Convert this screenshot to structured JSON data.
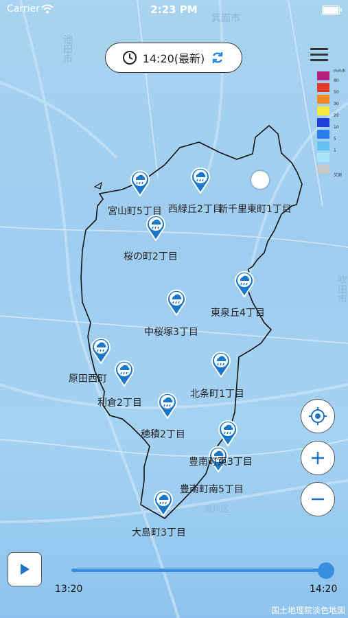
{
  "status_bar": {
    "carrier": "Carrier",
    "time": "2:23 PM"
  },
  "time_selector": {
    "label": "14:20(最新)"
  },
  "legend": {
    "unit": "mm/h",
    "items": [
      {
        "label": "80",
        "color": "#b0207c"
      },
      {
        "label": "50",
        "color": "#e03a2a"
      },
      {
        "label": "30",
        "color": "#f08a20"
      },
      {
        "label": "20",
        "color": "#f5e840"
      },
      {
        "label": "10",
        "color": "#1f3fd8"
      },
      {
        "label": "5",
        "color": "#2b7de8"
      },
      {
        "label": "1",
        "color": "#63c2f2"
      },
      {
        "label": "",
        "color": "#a9e6fb"
      },
      {
        "label": "欠測",
        "color": "#c8c8c8"
      }
    ]
  },
  "places": [
    {
      "name": "宮山町5丁目"
    },
    {
      "name": "西緑丘2丁目"
    },
    {
      "name": "新千里東町1丁目"
    },
    {
      "name": "桜の町2丁目"
    },
    {
      "name": "東泉丘4丁目"
    },
    {
      "name": "中桜塚3丁目"
    },
    {
      "name": "原田西町"
    },
    {
      "name": "北条町1丁目"
    },
    {
      "name": "利倉2丁目"
    },
    {
      "name": "穂積2丁目"
    },
    {
      "name": "豊南町東3丁目"
    },
    {
      "name": "豊南町南5丁目"
    },
    {
      "name": "大島町3丁目"
    }
  ],
  "map_labels": {
    "ikeda": "池田市",
    "minoh": "箕面市",
    "suita": "吹田市",
    "yodogawa": "淀川区"
  },
  "timeline": {
    "start": "13:20",
    "end": "14:20",
    "position": 1.0
  },
  "attribution": "国土地理院淡色地図",
  "colors": {
    "accent": "#3a8ee0",
    "pin": "#1b78c9"
  }
}
